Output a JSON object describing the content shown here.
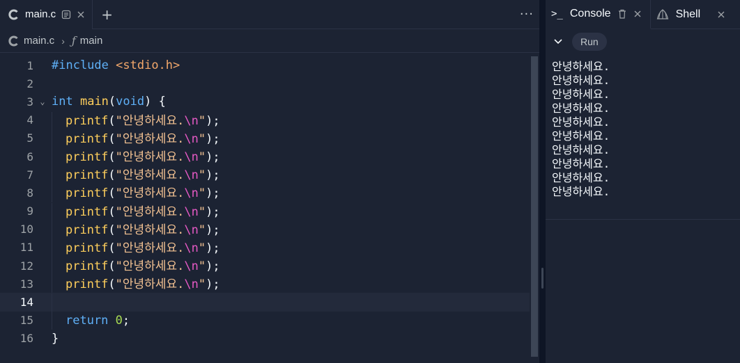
{
  "editor": {
    "tab": {
      "label": "main.c"
    },
    "add_tab": "+",
    "more": "···",
    "breadcrumb": {
      "file": "main.c",
      "symbol": "main"
    },
    "current_line": 14,
    "lines": [
      {
        "n": "1"
      },
      {
        "n": "2"
      },
      {
        "n": "3"
      },
      {
        "n": "4"
      },
      {
        "n": "5"
      },
      {
        "n": "6"
      },
      {
        "n": "7"
      },
      {
        "n": "8"
      },
      {
        "n": "9"
      },
      {
        "n": "10"
      },
      {
        "n": "11"
      },
      {
        "n": "12"
      },
      {
        "n": "13"
      },
      {
        "n": "14"
      },
      {
        "n": "15"
      },
      {
        "n": "16"
      }
    ],
    "code": {
      "include_directive": "#include",
      "include_header": "<stdio.h>",
      "type_int": "int",
      "main_name": "main",
      "void_kw": "void",
      "printf_name": "printf",
      "string_text": "안녕하세요.",
      "escape": "\\n",
      "return_kw": "return",
      "return_value": "0"
    }
  },
  "console": {
    "tabs": [
      {
        "label": "Console",
        "active": true
      },
      {
        "label": "Shell",
        "active": false
      }
    ],
    "run_label": "Run",
    "output": [
      "안녕하세요.",
      "안녕하세요.",
      "안녕하세요.",
      "안녕하세요.",
      "안녕하세요.",
      "안녕하세요.",
      "안녕하세요.",
      "안녕하세요.",
      "안녕하세요.",
      "안녕하세요."
    ]
  },
  "colors": {
    "background": "#1c2333",
    "keyword": "#5fb0f7",
    "function": "#ffcf5c",
    "string": "#f3c292",
    "escape": "#e559c4",
    "number": "#a8db52"
  },
  "icons": {
    "file_tab": "c-language-icon",
    "doc": "document-icon",
    "close": "close-icon",
    "trash": "trash-icon",
    "shell": "shell-icon",
    "fold": "chevron-down-icon"
  }
}
